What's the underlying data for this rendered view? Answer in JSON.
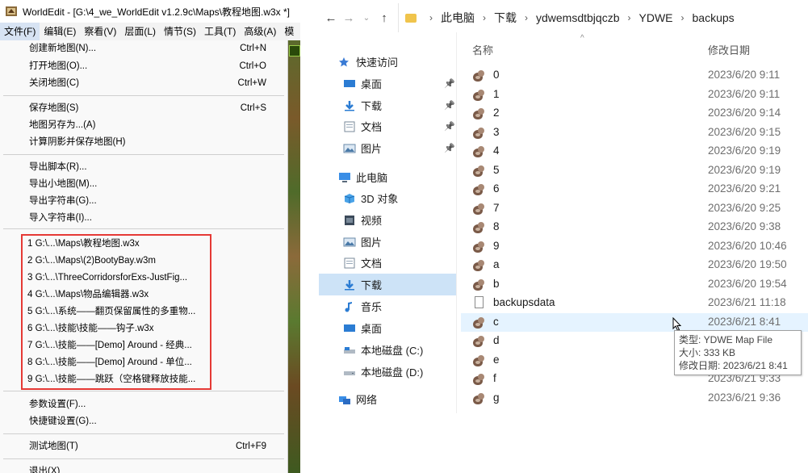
{
  "worldedit": {
    "title": "WorldEdit - [G:\\4_we_WorldEdit v1.2.9c\\Maps\\教程地图.w3x *]",
    "menubar": [
      "文件(F)",
      "编辑(E)",
      "察看(V)",
      "层面(L)",
      "情节(S)",
      "工具(T)",
      "高级(A)",
      "模"
    ],
    "file_menu": [
      {
        "label": "创建新地图(N)...",
        "shortcut": "Ctrl+N"
      },
      {
        "label": "打开地图(O)...",
        "shortcut": "Ctrl+O"
      },
      {
        "label": "关闭地图(C)",
        "shortcut": "Ctrl+W"
      },
      {
        "label": "保存地图(S)",
        "shortcut": "Ctrl+S"
      },
      {
        "label": "地图另存为...(A)",
        "shortcut": ""
      },
      {
        "label": "计算阴影并保存地图(H)",
        "shortcut": ""
      },
      {
        "label": "导出脚本(R)...",
        "shortcut": ""
      },
      {
        "label": "导出小地图(M)...",
        "shortcut": ""
      },
      {
        "label": "导出字符串(G)...",
        "shortcut": ""
      },
      {
        "label": "导入字符串(I)...",
        "shortcut": ""
      },
      {
        "label": "参数设置(F)...",
        "shortcut": ""
      },
      {
        "label": "快捷键设置(G)...",
        "shortcut": ""
      },
      {
        "label": "测试地图(T)",
        "shortcut": "Ctrl+F9"
      },
      {
        "label": "退出(X)",
        "shortcut": ""
      }
    ],
    "recent_files": [
      "1 G:\\...\\Maps\\教程地图.w3x",
      "2 G:\\...\\Maps\\(2)BootyBay.w3m",
      "3 G:\\...\\ThreeCorridorsforExs-JustFig...",
      "4 G:\\...\\Maps\\物品编辑器.w3x",
      "5 G:\\...\\系统——翻页保留属性的多重物...",
      "6 G:\\...\\技能\\技能——钩子.w3x",
      "7 G:\\...\\技能——[Demo] Around - 经典...",
      "8 G:\\...\\技能——[Demo] Around - 单位...",
      "9 G:\\...\\技能——跳跃（空格键释放技能..."
    ]
  },
  "explorer": {
    "breadcrumb": [
      "此电脑",
      "下载",
      "ydwemsdtbjqczb",
      "YDWE",
      "backups"
    ],
    "nav": [
      {
        "label": "快速访问",
        "icon": "star-icon",
        "pinned": false,
        "selected": false
      },
      {
        "label": "桌面",
        "icon": "desktop-icon",
        "pinned": true,
        "selected": false
      },
      {
        "label": "下载",
        "icon": "download-icon",
        "pinned": true,
        "selected": false
      },
      {
        "label": "文档",
        "icon": "document-icon",
        "pinned": true,
        "selected": false
      },
      {
        "label": "图片",
        "icon": "picture-icon",
        "pinned": true,
        "selected": false
      },
      {
        "label": "此电脑",
        "icon": "computer-icon",
        "pinned": false,
        "selected": false
      },
      {
        "label": "3D 对象",
        "icon": "cube-icon",
        "pinned": false,
        "selected": false
      },
      {
        "label": "视频",
        "icon": "video-icon",
        "pinned": false,
        "selected": false
      },
      {
        "label": "图片",
        "icon": "picture-icon",
        "pinned": false,
        "selected": false
      },
      {
        "label": "文档",
        "icon": "document-icon",
        "pinned": false,
        "selected": false
      },
      {
        "label": "下载",
        "icon": "download-icon",
        "pinned": false,
        "selected": true
      },
      {
        "label": "音乐",
        "icon": "music-icon",
        "pinned": false,
        "selected": false
      },
      {
        "label": "桌面",
        "icon": "desktop-icon",
        "pinned": false,
        "selected": false
      },
      {
        "label": "本地磁盘 (C:)",
        "icon": "drive-c-icon",
        "pinned": false,
        "selected": false
      },
      {
        "label": "本地磁盘 (D:)",
        "icon": "drive-d-icon",
        "pinned": false,
        "selected": false
      },
      {
        "label": "网络",
        "icon": "network-icon",
        "pinned": false,
        "selected": false
      }
    ],
    "columns": {
      "name": "名称",
      "modified": "修改日期"
    },
    "files": [
      {
        "name": "0",
        "date": "2023/6/20 9:11",
        "type": "map"
      },
      {
        "name": "1",
        "date": "2023/6/20 9:11",
        "type": "map"
      },
      {
        "name": "2",
        "date": "2023/6/20 9:14",
        "type": "map"
      },
      {
        "name": "3",
        "date": "2023/6/20 9:15",
        "type": "map"
      },
      {
        "name": "4",
        "date": "2023/6/20 9:19",
        "type": "map"
      },
      {
        "name": "5",
        "date": "2023/6/20 9:19",
        "type": "map"
      },
      {
        "name": "6",
        "date": "2023/6/20 9:21",
        "type": "map"
      },
      {
        "name": "7",
        "date": "2023/6/20 9:25",
        "type": "map"
      },
      {
        "name": "8",
        "date": "2023/6/20 9:38",
        "type": "map"
      },
      {
        "name": "9",
        "date": "2023/6/20 10:46",
        "type": "map"
      },
      {
        "name": "a",
        "date": "2023/6/20 19:50",
        "type": "map"
      },
      {
        "name": "b",
        "date": "2023/6/20 19:54",
        "type": "map"
      },
      {
        "name": "backupsdata",
        "date": "2023/6/21 11:18",
        "type": "file"
      },
      {
        "name": "c",
        "date": "2023/6/21 8:41",
        "type": "map"
      },
      {
        "name": "d",
        "date": "",
        "type": "map"
      },
      {
        "name": "e",
        "date": "",
        "type": "map"
      },
      {
        "name": "f",
        "date": "2023/6/21 9:33",
        "type": "map"
      },
      {
        "name": "g",
        "date": "2023/6/21 9:36",
        "type": "map"
      }
    ],
    "tooltip": {
      "type_line": "类型: YDWE Map File",
      "size_line": "大小: 333 KB",
      "date_line": "修改日期: 2023/6/21 8:41"
    },
    "colors": {
      "selected_nav": "#cde3f7",
      "hover_row": "#e5f3ff",
      "recent_box": "#e53935"
    }
  }
}
